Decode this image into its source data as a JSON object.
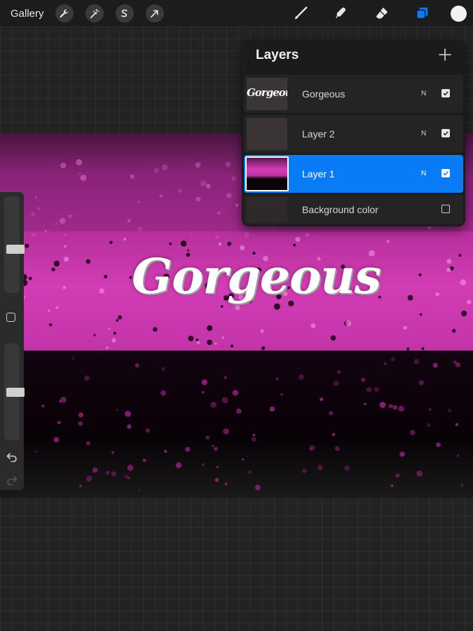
{
  "toolbar": {
    "gallery_label": "Gallery",
    "left_tools": [
      "wrench-icon",
      "magic-wand-icon",
      "selection-icon",
      "transform-arrow-icon"
    ],
    "right_tools": [
      "brush-icon",
      "smudge-icon",
      "eraser-icon",
      "layers-icon"
    ],
    "accent_color": "#0a7bf6",
    "current_color": "#f2f2f2"
  },
  "canvas": {
    "artwork_text": "Gorgeous",
    "colors": {
      "pink": "#d23cb4",
      "dark": "#080206"
    }
  },
  "layers_panel": {
    "title": "Layers",
    "add_icon": "plus-icon",
    "layers": [
      {
        "name": "Gorgeous",
        "blend": "N",
        "visible": true,
        "thumb_text": "Gorgeous",
        "active": false
      },
      {
        "name": "Layer 2",
        "blend": "N",
        "visible": true,
        "active": false
      },
      {
        "name": "Layer 1",
        "blend": "N",
        "visible": true,
        "active": true
      },
      {
        "name": "Background color",
        "visible": false,
        "active": false
      }
    ]
  },
  "sidebar": {
    "brush_size_level": 0.45,
    "opacity_level": 0.5
  }
}
